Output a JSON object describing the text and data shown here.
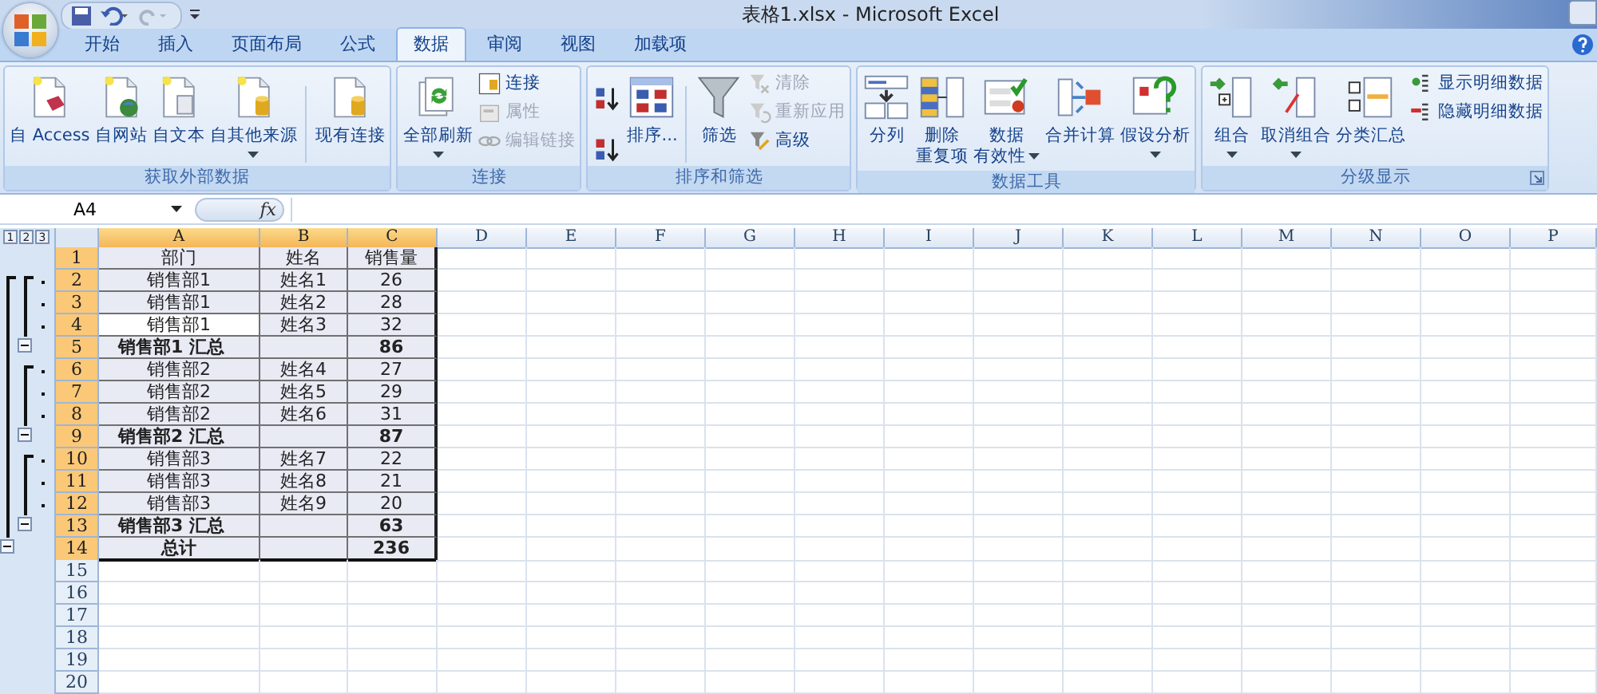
{
  "window": {
    "title": "表格1.xlsx - Microsoft Excel"
  },
  "tabs": [
    {
      "label": "开始",
      "selected": false
    },
    {
      "label": "插入",
      "selected": false
    },
    {
      "label": "页面布局",
      "selected": false
    },
    {
      "label": "公式",
      "selected": false
    },
    {
      "label": "数据",
      "selected": true
    },
    {
      "label": "审阅",
      "selected": false
    },
    {
      "label": "视图",
      "selected": false
    },
    {
      "label": "加载项",
      "selected": false
    }
  ],
  "ribbon_groups": [
    {
      "title": "获取外部数据",
      "columns": [
        {
          "kind": "large",
          "lines": [
            "自 Access"
          ]
        },
        {
          "kind": "large",
          "lines": [
            "自网站"
          ]
        },
        {
          "kind": "large",
          "lines": [
            "自文本"
          ]
        },
        {
          "kind": "large",
          "lines": [
            "自其他来源"
          ],
          "dropdown": true
        },
        {
          "kind": "divider"
        },
        {
          "kind": "large",
          "lines": [
            "现有连接"
          ]
        }
      ]
    },
    {
      "title": "连接",
      "columns": [
        {
          "kind": "large",
          "lines": [
            "全部刷新"
          ],
          "dropdown": true
        },
        {
          "kind": "stack",
          "items": [
            {
              "label": "连接",
              "disabled": false
            },
            {
              "label": "属性",
              "disabled": true
            },
            {
              "label": "编辑链接",
              "disabled": true
            }
          ]
        }
      ]
    },
    {
      "title": "排序和筛选",
      "columns": [
        {
          "kind": "sort_buttons"
        },
        {
          "kind": "large",
          "lines": [
            "排序..."
          ]
        },
        {
          "kind": "divider"
        },
        {
          "kind": "large",
          "lines": [
            "筛选"
          ]
        },
        {
          "kind": "stack",
          "items": [
            {
              "label": "清除",
              "disabled": true
            },
            {
              "label": "重新应用",
              "disabled": true
            },
            {
              "label": "高级",
              "disabled": false
            }
          ]
        }
      ]
    },
    {
      "title": "数据工具",
      "columns": [
        {
          "kind": "large",
          "lines": [
            "分列"
          ]
        },
        {
          "kind": "large",
          "lines": [
            "删除",
            "重复项"
          ]
        },
        {
          "kind": "large",
          "lines": [
            "数据",
            "有效性"
          ],
          "dropdown": true
        },
        {
          "kind": "large",
          "lines": [
            "合并计算"
          ]
        },
        {
          "kind": "large",
          "lines": [
            "假设分析"
          ],
          "dropdown": true
        }
      ]
    },
    {
      "title": "分级显示",
      "launcher": true,
      "columns": [
        {
          "kind": "large",
          "lines": [
            "组合"
          ],
          "dropdown": true
        },
        {
          "kind": "large",
          "lines": [
            "取消组合"
          ],
          "dropdown": true
        },
        {
          "kind": "large",
          "lines": [
            "分类汇总"
          ]
        },
        {
          "kind": "stack",
          "items": [
            {
              "label": "显示明细数据",
              "disabled": false
            },
            {
              "label": "隐藏明细数据",
              "disabled": false
            }
          ]
        }
      ]
    }
  ],
  "formula_bar": {
    "name_box": "A4",
    "function_label": "fx"
  },
  "outline_levels": [
    "1",
    "2",
    "3"
  ],
  "sheet": {
    "columns": [
      {
        "label": "A",
        "selected": true
      },
      {
        "label": "B",
        "selected": true
      },
      {
        "label": "C",
        "selected": true
      },
      {
        "label": "D",
        "selected": false
      },
      {
        "label": "E",
        "selected": false
      },
      {
        "label": "F",
        "selected": false
      },
      {
        "label": "G",
        "selected": false
      },
      {
        "label": "H",
        "selected": false
      },
      {
        "label": "I",
        "selected": false
      },
      {
        "label": "J",
        "selected": false
      },
      {
        "label": "K",
        "selected": false
      },
      {
        "label": "L",
        "selected": false
      },
      {
        "label": "M",
        "selected": false
      },
      {
        "label": "N",
        "selected": false
      },
      {
        "label": "O",
        "selected": false
      },
      {
        "label": "P",
        "selected": false
      }
    ],
    "rows": [
      {
        "number": "1",
        "selected": true,
        "kind": "header",
        "cells": [
          "部门",
          "姓名",
          "销售量"
        ]
      },
      {
        "number": "2",
        "selected": true,
        "kind": "detail",
        "cells": [
          "销售部1",
          "姓名1",
          "26"
        ]
      },
      {
        "number": "3",
        "selected": true,
        "kind": "detail",
        "cells": [
          "销售部1",
          "姓名2",
          "28"
        ]
      },
      {
        "number": "4",
        "selected": true,
        "kind": "detail",
        "active": true,
        "cells": [
          "销售部1",
          "姓名3",
          "32"
        ]
      },
      {
        "number": "5",
        "selected": true,
        "kind": "subtotal",
        "cells": [
          "销售部1 汇总",
          "",
          "86"
        ]
      },
      {
        "number": "6",
        "selected": true,
        "kind": "detail",
        "cells": [
          "销售部2",
          "姓名4",
          "27"
        ]
      },
      {
        "number": "7",
        "selected": true,
        "kind": "detail",
        "cells": [
          "销售部2",
          "姓名5",
          "29"
        ]
      },
      {
        "number": "8",
        "selected": true,
        "kind": "detail",
        "cells": [
          "销售部2",
          "姓名6",
          "31"
        ]
      },
      {
        "number": "9",
        "selected": true,
        "kind": "subtotal",
        "cells": [
          "销售部2 汇总",
          "",
          "87"
        ]
      },
      {
        "number": "10",
        "selected": true,
        "kind": "detail",
        "cells": [
          "销售部3",
          "姓名7",
          "22"
        ]
      },
      {
        "number": "11",
        "selected": true,
        "kind": "detail",
        "cells": [
          "销售部3",
          "姓名8",
          "21"
        ]
      },
      {
        "number": "12",
        "selected": true,
        "kind": "detail",
        "cells": [
          "销售部3",
          "姓名9",
          "20"
        ]
      },
      {
        "number": "13",
        "selected": true,
        "kind": "subtotal",
        "cells": [
          "销售部3 汇总",
          "",
          "63"
        ]
      },
      {
        "number": "14",
        "selected": true,
        "kind": "total",
        "cells": [
          "总计",
          "",
          "236"
        ]
      },
      {
        "number": "15",
        "selected": false,
        "kind": "empty",
        "cells": []
      },
      {
        "number": "16",
        "selected": false,
        "kind": "empty",
        "cells": []
      },
      {
        "number": "17",
        "selected": false,
        "kind": "empty",
        "cells": []
      },
      {
        "number": "18",
        "selected": false,
        "kind": "empty",
        "cells": []
      },
      {
        "number": "19",
        "selected": false,
        "kind": "empty",
        "cells": []
      },
      {
        "number": "20",
        "selected": false,
        "kind": "empty",
        "cells": []
      }
    ]
  }
}
